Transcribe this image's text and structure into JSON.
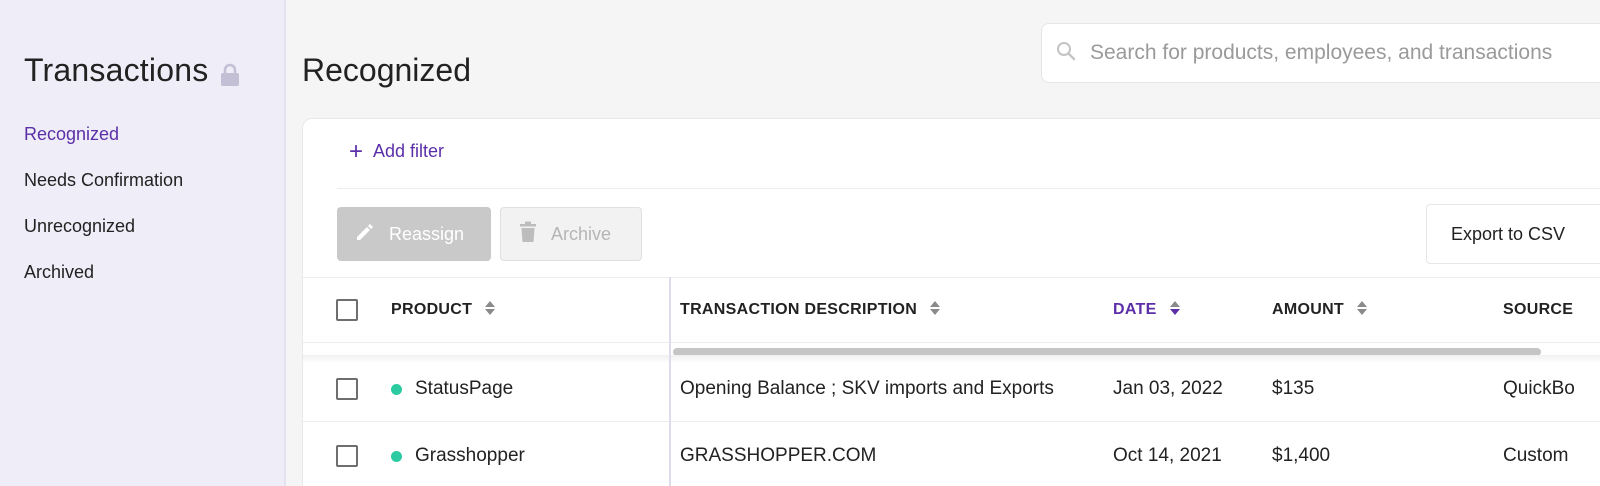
{
  "sidebar": {
    "title": "Transactions",
    "items": [
      {
        "label": "Recognized",
        "active": true
      },
      {
        "label": "Needs Confirmation",
        "active": false
      },
      {
        "label": "Unrecognized",
        "active": false
      },
      {
        "label": "Archived",
        "active": false
      }
    ]
  },
  "page": {
    "title": "Recognized",
    "search_placeholder": "Search for products, employees, and transactions"
  },
  "toolbar": {
    "add_filter": "Add filter",
    "reassign": "Reassign",
    "archive": "Archive",
    "export": "Export to CSV"
  },
  "table": {
    "columns": [
      "PRODUCT",
      "TRANSACTION DESCRIPTION",
      "DATE",
      "AMOUNT",
      "SOURCE"
    ],
    "sorted_column": "DATE",
    "rows": [
      {
        "product": "StatusPage",
        "description": "Opening Balance ; SKV imports and Exports",
        "date": "Jan 03, 2022",
        "amount": "$135",
        "source": "QuickBo"
      },
      {
        "product": "Grasshopper",
        "description": "GRASSHOPPER.COM",
        "date": "Oct 14, 2021",
        "amount": "$1,400",
        "source": "Custom"
      }
    ]
  },
  "colors": {
    "accent": "#5b2fa8",
    "status_dot": "#2ccaa1"
  }
}
